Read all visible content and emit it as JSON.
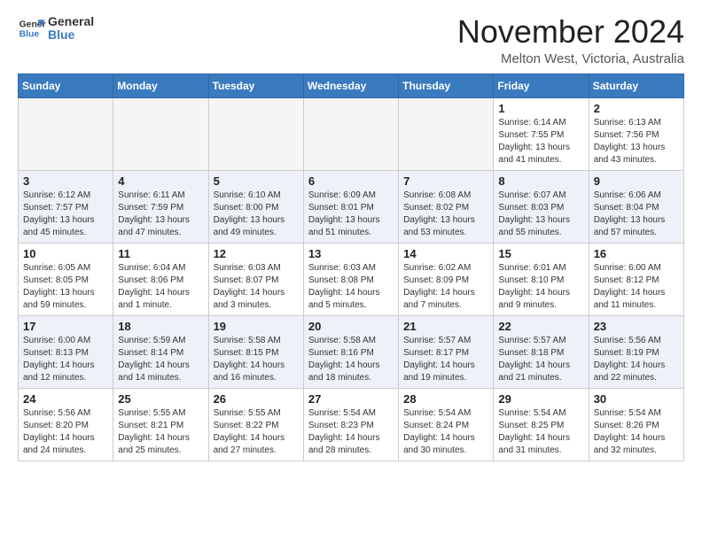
{
  "header": {
    "logo_general": "General",
    "logo_blue": "Blue",
    "month_title": "November 2024",
    "location": "Melton West, Victoria, Australia"
  },
  "weekdays": [
    "Sunday",
    "Monday",
    "Tuesday",
    "Wednesday",
    "Thursday",
    "Friday",
    "Saturday"
  ],
  "weeks": [
    [
      {
        "day": "",
        "info": ""
      },
      {
        "day": "",
        "info": ""
      },
      {
        "day": "",
        "info": ""
      },
      {
        "day": "",
        "info": ""
      },
      {
        "day": "",
        "info": ""
      },
      {
        "day": "1",
        "info": "Sunrise: 6:14 AM\nSunset: 7:55 PM\nDaylight: 13 hours\nand 41 minutes."
      },
      {
        "day": "2",
        "info": "Sunrise: 6:13 AM\nSunset: 7:56 PM\nDaylight: 13 hours\nand 43 minutes."
      }
    ],
    [
      {
        "day": "3",
        "info": "Sunrise: 6:12 AM\nSunset: 7:57 PM\nDaylight: 13 hours\nand 45 minutes."
      },
      {
        "day": "4",
        "info": "Sunrise: 6:11 AM\nSunset: 7:59 PM\nDaylight: 13 hours\nand 47 minutes."
      },
      {
        "day": "5",
        "info": "Sunrise: 6:10 AM\nSunset: 8:00 PM\nDaylight: 13 hours\nand 49 minutes."
      },
      {
        "day": "6",
        "info": "Sunrise: 6:09 AM\nSunset: 8:01 PM\nDaylight: 13 hours\nand 51 minutes."
      },
      {
        "day": "7",
        "info": "Sunrise: 6:08 AM\nSunset: 8:02 PM\nDaylight: 13 hours\nand 53 minutes."
      },
      {
        "day": "8",
        "info": "Sunrise: 6:07 AM\nSunset: 8:03 PM\nDaylight: 13 hours\nand 55 minutes."
      },
      {
        "day": "9",
        "info": "Sunrise: 6:06 AM\nSunset: 8:04 PM\nDaylight: 13 hours\nand 57 minutes."
      }
    ],
    [
      {
        "day": "10",
        "info": "Sunrise: 6:05 AM\nSunset: 8:05 PM\nDaylight: 13 hours\nand 59 minutes."
      },
      {
        "day": "11",
        "info": "Sunrise: 6:04 AM\nSunset: 8:06 PM\nDaylight: 14 hours\nand 1 minute."
      },
      {
        "day": "12",
        "info": "Sunrise: 6:03 AM\nSunset: 8:07 PM\nDaylight: 14 hours\nand 3 minutes."
      },
      {
        "day": "13",
        "info": "Sunrise: 6:03 AM\nSunset: 8:08 PM\nDaylight: 14 hours\nand 5 minutes."
      },
      {
        "day": "14",
        "info": "Sunrise: 6:02 AM\nSunset: 8:09 PM\nDaylight: 14 hours\nand 7 minutes."
      },
      {
        "day": "15",
        "info": "Sunrise: 6:01 AM\nSunset: 8:10 PM\nDaylight: 14 hours\nand 9 minutes."
      },
      {
        "day": "16",
        "info": "Sunrise: 6:00 AM\nSunset: 8:12 PM\nDaylight: 14 hours\nand 11 minutes."
      }
    ],
    [
      {
        "day": "17",
        "info": "Sunrise: 6:00 AM\nSunset: 8:13 PM\nDaylight: 14 hours\nand 12 minutes."
      },
      {
        "day": "18",
        "info": "Sunrise: 5:59 AM\nSunset: 8:14 PM\nDaylight: 14 hours\nand 14 minutes."
      },
      {
        "day": "19",
        "info": "Sunrise: 5:58 AM\nSunset: 8:15 PM\nDaylight: 14 hours\nand 16 minutes."
      },
      {
        "day": "20",
        "info": "Sunrise: 5:58 AM\nSunset: 8:16 PM\nDaylight: 14 hours\nand 18 minutes."
      },
      {
        "day": "21",
        "info": "Sunrise: 5:57 AM\nSunset: 8:17 PM\nDaylight: 14 hours\nand 19 minutes."
      },
      {
        "day": "22",
        "info": "Sunrise: 5:57 AM\nSunset: 8:18 PM\nDaylight: 14 hours\nand 21 minutes."
      },
      {
        "day": "23",
        "info": "Sunrise: 5:56 AM\nSunset: 8:19 PM\nDaylight: 14 hours\nand 22 minutes."
      }
    ],
    [
      {
        "day": "24",
        "info": "Sunrise: 5:56 AM\nSunset: 8:20 PM\nDaylight: 14 hours\nand 24 minutes."
      },
      {
        "day": "25",
        "info": "Sunrise: 5:55 AM\nSunset: 8:21 PM\nDaylight: 14 hours\nand 25 minutes."
      },
      {
        "day": "26",
        "info": "Sunrise: 5:55 AM\nSunset: 8:22 PM\nDaylight: 14 hours\nand 27 minutes."
      },
      {
        "day": "27",
        "info": "Sunrise: 5:54 AM\nSunset: 8:23 PM\nDaylight: 14 hours\nand 28 minutes."
      },
      {
        "day": "28",
        "info": "Sunrise: 5:54 AM\nSunset: 8:24 PM\nDaylight: 14 hours\nand 30 minutes."
      },
      {
        "day": "29",
        "info": "Sunrise: 5:54 AM\nSunset: 8:25 PM\nDaylight: 14 hours\nand 31 minutes."
      },
      {
        "day": "30",
        "info": "Sunrise: 5:54 AM\nSunset: 8:26 PM\nDaylight: 14 hours\nand 32 minutes."
      }
    ]
  ]
}
